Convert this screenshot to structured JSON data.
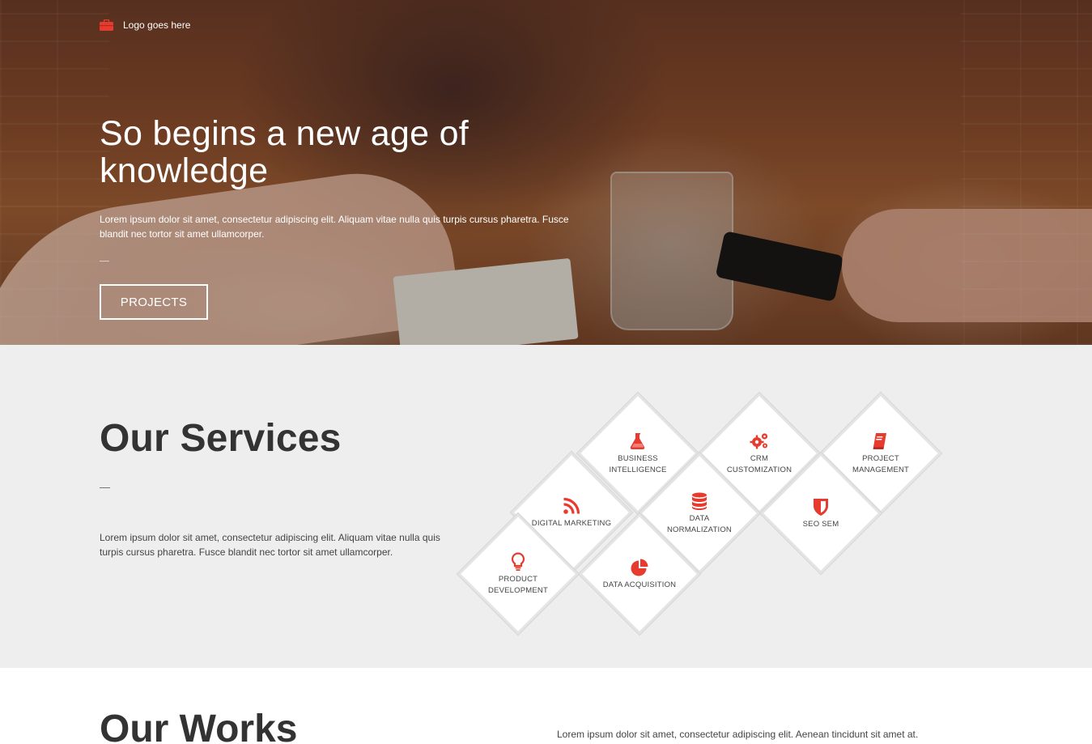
{
  "header": {
    "logo_text": "Logo goes here",
    "logo_icon": "briefcase-icon"
  },
  "hero": {
    "title": "So begins a new age of knowledge",
    "text": "Lorem ipsum dolor sit amet, consectetur adipiscing elit. Aliquam vitae nulla quis turpis cursus pharetra. Fusce blandit nec tortor sit amet ullamcorper.",
    "button_label": "PROJECTS"
  },
  "services": {
    "title": "Our Services",
    "text": "Lorem ipsum dolor sit amet, consectetur adipiscing elit. Aliquam vitae nulla quis turpis cursus pharetra. Fusce blandit nec tortor sit amet ullamcorper.",
    "accent_color": "#e63b2e",
    "items": [
      {
        "label": "BUSINESS\nINTELLIGENCE",
        "icon": "flask-icon"
      },
      {
        "label": "CRM\nCUSTOMIZATION",
        "icon": "gears-icon"
      },
      {
        "label": "PROJECT\nMANAGEMENT",
        "icon": "book-icon"
      },
      {
        "label": "DIGITAL MARKETING",
        "icon": "rss-icon"
      },
      {
        "label": "DATA\nNORMALIZATION",
        "icon": "database-icon"
      },
      {
        "label": "SEO SEM",
        "icon": "shield-icon"
      },
      {
        "label": "PRODUCT\nDEVELOPMENT",
        "icon": "lightbulb-icon"
      },
      {
        "label": "DATA ACQUISITION",
        "icon": "pie-chart-icon"
      }
    ]
  },
  "works": {
    "title": "Our Works",
    "text": "Lorem ipsum dolor sit amet, consectetur adipiscing elit. Aenean tincidunt sit amet at."
  }
}
